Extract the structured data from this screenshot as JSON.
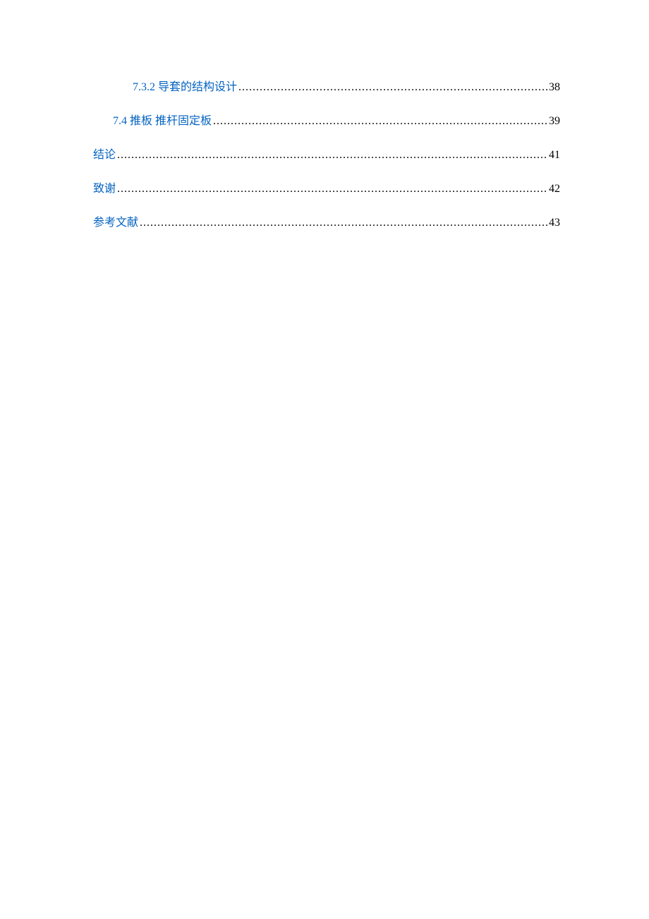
{
  "toc": {
    "entries": [
      {
        "label": "7.3.2 导套的结构设计",
        "page": "38",
        "level": 3,
        "isLink": true
      },
      {
        "label": "7.4 推板 推杆固定板",
        "page": "39",
        "level": 2,
        "isLink": true
      },
      {
        "label": "结论",
        "page": "41",
        "level": 1,
        "isLink": true
      },
      {
        "label": "致谢",
        "page": "42",
        "level": 1,
        "isLink": true
      },
      {
        "label": "参考文献",
        "page": "43",
        "level": 1,
        "isLink": true
      }
    ]
  },
  "leader_dots": "...................................................................................................................................................................."
}
